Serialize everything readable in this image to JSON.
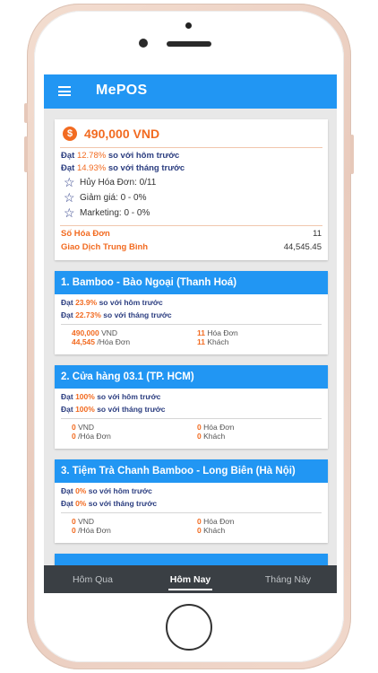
{
  "app": {
    "title": "MePOS"
  },
  "summary": {
    "amount": "490,000 VND",
    "coin_symbol": "$",
    "day": {
      "prefix": "Đạt",
      "pct": "12.78%",
      "suffix": "so với hôm trước"
    },
    "month": {
      "prefix": "Đạt",
      "pct": "14.93%",
      "suffix": "so với tháng trước"
    },
    "stars": [
      "Hủy Hóa Đơn: 0/11",
      "Giảm giá: 0 - 0%",
      "Marketing: 0 - 0%"
    ],
    "invoice_label": "Số Hóa Đơn",
    "invoice_value": "11",
    "avg_label": "Giao Dịch Trung Bình",
    "avg_value": "44,545.45"
  },
  "stores": [
    {
      "name": "1. Bamboo - Bào Ngoại (Thanh Hoá)",
      "day": {
        "prefix": "Đạt",
        "pct": "23.9%",
        "suffix": "so với hôm trước"
      },
      "month": {
        "prefix": "Đạt",
        "pct": "22.73%",
        "suffix": "so với tháng trước"
      },
      "revenue_value": "490,000",
      "revenue_unit": "VND",
      "avg_value": "44,545",
      "avg_unit": "/Hóa Đơn",
      "invoices_value": "11",
      "invoices_unit": "Hóa Đơn",
      "customers_value": "11",
      "customers_unit": "Khách"
    },
    {
      "name": "2. Cửa hàng 03.1 (TP. HCM)",
      "day": {
        "prefix": "Đạt",
        "pct": "100%",
        "suffix": "so với hôm trước"
      },
      "month": {
        "prefix": "Đạt",
        "pct": "100%",
        "suffix": "so với tháng trước"
      },
      "revenue_value": "0",
      "revenue_unit": "VND",
      "avg_value": "0",
      "avg_unit": "/Hóa Đơn",
      "invoices_value": "0",
      "invoices_unit": "Hóa Đơn",
      "customers_value": "0",
      "customers_unit": "Khách"
    },
    {
      "name": "3. Tiệm Trà Chanh Bamboo - Long Biên (Hà Nội)",
      "day": {
        "prefix": "Đạt",
        "pct": "0%",
        "suffix": "so với hôm trước"
      },
      "month": {
        "prefix": "Đạt",
        "pct": "0%",
        "suffix": "so với tháng trước"
      },
      "revenue_value": "0",
      "revenue_unit": "VND",
      "avg_value": "0",
      "avg_unit": "/Hóa Đơn",
      "invoices_value": "0",
      "invoices_unit": "Hóa Đơn",
      "customers_value": "0",
      "customers_unit": "Khách"
    }
  ],
  "tabs": [
    "Hôm Qua",
    "Hôm Nay",
    "Tháng Này"
  ],
  "active_tab": "Hôm Nay",
  "colors": {
    "primary": "#2196f3",
    "accent": "#f26b21",
    "navy": "#2c3e80",
    "tabbar": "#3a3f44"
  }
}
